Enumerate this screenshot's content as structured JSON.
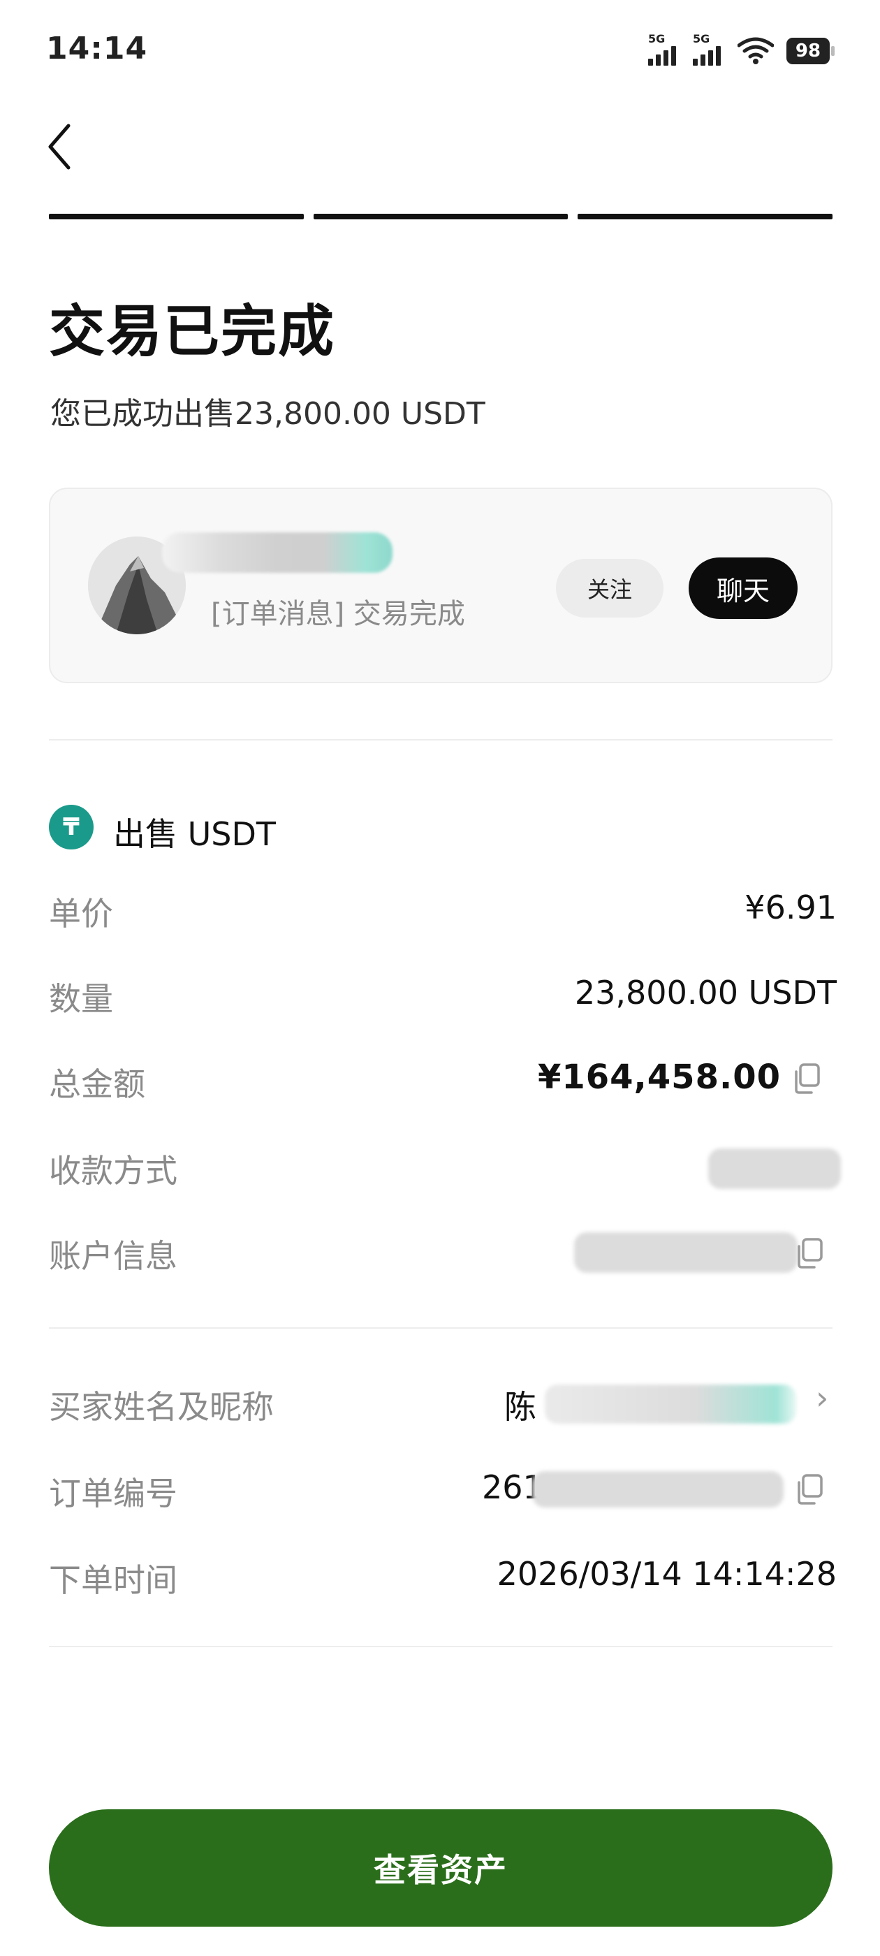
{
  "status_bar": {
    "time": "14:14",
    "signal_1": "5G",
    "signal_2": "5G",
    "battery": "98"
  },
  "header": {
    "title": "交易已完成",
    "subtitle": "您已成功出售23,800.00 USDT"
  },
  "counterparty": {
    "order_message": "[订单消息] 交易完成",
    "follow_label": "关注",
    "chat_label": "聊天"
  },
  "asset": {
    "coin_symbol": "₸",
    "title": "出售 USDT",
    "icon_color": "#1a9a8a"
  },
  "details": [
    {
      "label": "单价",
      "value": "¥6.91"
    },
    {
      "label": "数量",
      "value": "23,800.00 USDT"
    },
    {
      "label": "总金额",
      "value": "¥164,458.00"
    },
    {
      "label": "收款方式",
      "value": ""
    },
    {
      "label": "账户信息",
      "value": ""
    }
  ],
  "order": [
    {
      "label": "买家姓名及昵称",
      "value": "陈"
    },
    {
      "label": "订单编号",
      "value": "261"
    },
    {
      "label": "下单时间",
      "value": "2026/03/14 14:14:28"
    }
  ],
  "cta": {
    "label": "查看资产",
    "color": "#2a6e1b"
  }
}
